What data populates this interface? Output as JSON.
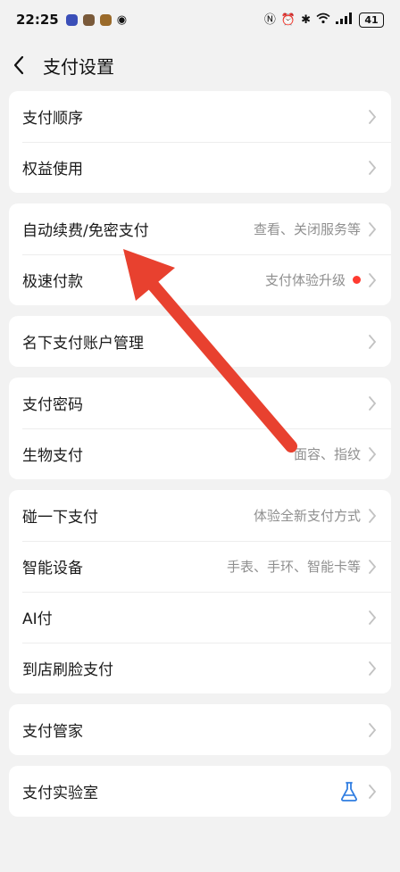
{
  "status_bar": {
    "time": "22:25",
    "battery": "41"
  },
  "header": {
    "title": "支付设置"
  },
  "groups": [
    {
      "rows": [
        {
          "label": "支付顺序"
        },
        {
          "label": "权益使用"
        }
      ]
    },
    {
      "rows": [
        {
          "label": "自动续费/免密支付",
          "hint": "查看、关闭服务等"
        },
        {
          "label": "极速付款",
          "hint": "支付体验升级"
        }
      ]
    },
    {
      "rows": [
        {
          "label": "名下支付账户管理"
        }
      ]
    },
    {
      "rows": [
        {
          "label": "支付密码"
        },
        {
          "label": "生物支付",
          "hint": "面容、指纹"
        }
      ]
    },
    {
      "rows": [
        {
          "label": "碰一下支付",
          "hint": "体验全新支付方式"
        },
        {
          "label": "智能设备",
          "hint": "手表、手环、智能卡等"
        },
        {
          "label": "AI付"
        },
        {
          "label": "到店刷脸支付"
        }
      ]
    },
    {
      "rows": [
        {
          "label": "支付管家"
        }
      ]
    },
    {
      "rows": [
        {
          "label": "支付实验室"
        }
      ]
    }
  ],
  "colors": {
    "accent_dot": "#ff3b30",
    "annotation_arrow": "#e8412f",
    "flask_icon": "#2f7de1"
  },
  "icons": {
    "back": "chevron-left-icon",
    "row": "chevron-right-icon",
    "lab": "flask-icon"
  }
}
